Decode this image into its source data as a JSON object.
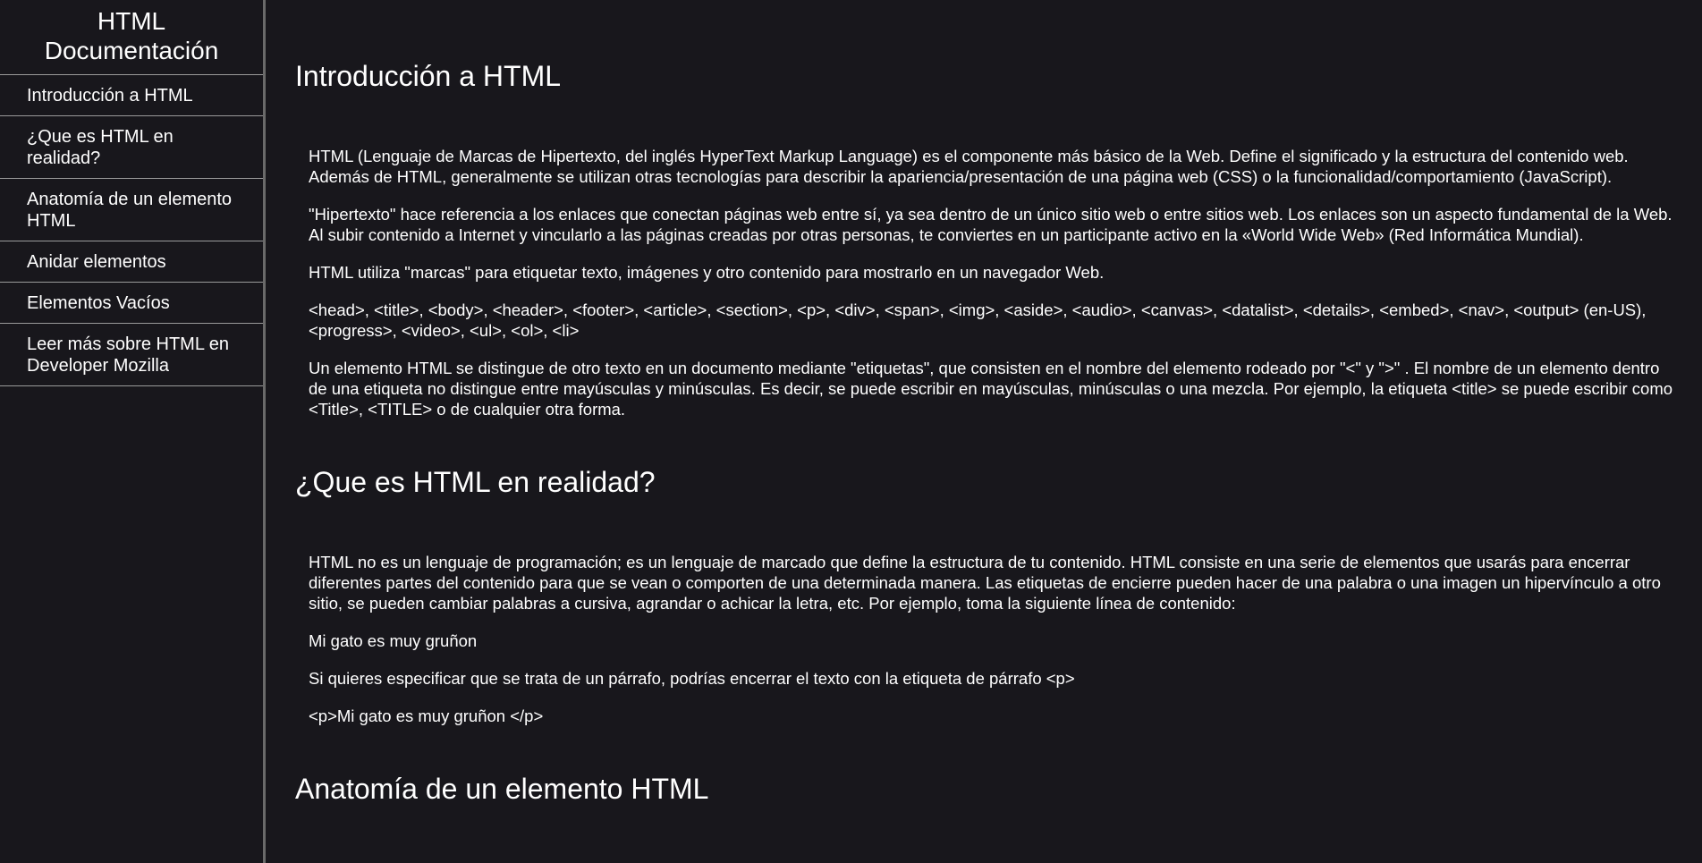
{
  "navbar": {
    "title": "HTML Documentación",
    "links": [
      {
        "label": "Introducción a HTML"
      },
      {
        "label": "¿Que es HTML en realidad?"
      },
      {
        "label": "Anatomía de un elemento HTML"
      },
      {
        "label": "Anidar elementos"
      },
      {
        "label": "Elementos Vacíos"
      },
      {
        "label": "Leer más sobre HTML en Developer Mozilla"
      }
    ]
  },
  "main": {
    "sections": [
      {
        "title": "Introducción a HTML",
        "paragraphs": [
          "HTML (Lenguaje de Marcas de Hipertexto, del inglés HyperText Markup Language) es el componente más básico de la Web. Define el significado y la estructura del contenido web. Además de HTML, generalmente se utilizan otras tecnologías para describir la apariencia/presentación de una página web (CSS) o la funcionalidad/comportamiento (JavaScript).",
          "\"Hipertexto\" hace referencia a los enlaces que conectan páginas web entre sí, ya sea dentro de un único sitio web o entre sitios web. Los enlaces son un aspecto fundamental de la Web. Al subir contenido a Internet y vincularlo a las páginas creadas por otras personas, te conviertes en un participante activo en la «World Wide Web» (Red Informática Mundial).",
          "HTML utiliza \"marcas\" para etiquetar texto, imágenes y otro contenido para mostrarlo en un navegador Web.",
          "<head>, <title>, <body>, <header>, <footer>, <article>, <section>, <p>, <div>, <span>, <img>, <aside>, <audio>, <canvas>, <datalist>, <details>, <embed>, <nav>, <output> (en-US), <progress>, <video>, <ul>, <ol>, <li>",
          "Un elemento HTML se distingue de otro texto en un documento mediante \"etiquetas\", que consisten en el nombre del elemento rodeado por \"<\" y \">\" . El nombre de un elemento dentro de una etiqueta no distingue entre mayúsculas y minúsculas. Es decir, se puede escribir en mayúsculas, minúsculas o una mezcla. Por ejemplo, la etiqueta <title> se puede escribir como <Title>, <TITLE> o de cualquier otra forma."
        ]
      },
      {
        "title": "¿Que es HTML en realidad?",
        "paragraphs": [
          "HTML no es un lenguaje de programación; es un lenguaje de marcado que define la estructura de tu contenido. HTML consiste en una serie de elementos que usarás para encerrar diferentes partes del contenido para que se vean o comporten de una determinada manera. Las etiquetas de encierre pueden hacer de una palabra o una imagen un hipervínculo a otro sitio, se pueden cambiar palabras a cursiva, agrandar o achicar la letra, etc. Por ejemplo, toma la siguiente línea de contenido:",
          "Mi gato es muy gruñon",
          "Si quieres especificar que se trata de un párrafo, podrías encerrar el texto con la etiqueta de párrafo <p>",
          "<p>Mi gato es muy gruñon </p>"
        ]
      },
      {
        "title": "Anatomía de un elemento HTML"
      }
    ]
  }
}
